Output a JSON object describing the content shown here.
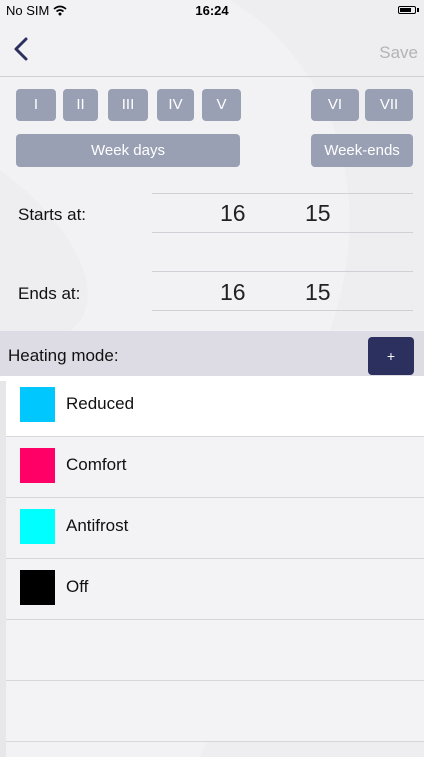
{
  "status_bar": {
    "carrier": "No SIM",
    "time": "16:24"
  },
  "nav": {
    "back_icon": "chevron-left-icon",
    "save_label": "Save",
    "back_color": "#2c305f",
    "save_color": "#b3b3b8"
  },
  "days": {
    "weekdays": [
      "I",
      "II",
      "III",
      "IV",
      "V"
    ],
    "weekend": [
      "VI",
      "VII"
    ],
    "week_days_label": "Week days",
    "week_ends_label": "Week-ends",
    "button_color": "#9aa0b4"
  },
  "schedule": {
    "starts_label": "Starts at:",
    "starts_hour": "16",
    "starts_minute": "15",
    "ends_label": "Ends at:",
    "ends_hour": "16",
    "ends_minute": "15"
  },
  "heating": {
    "header_label": "Heating mode:",
    "add_label": "+",
    "add_color": "#2c305f",
    "modes": [
      {
        "label": "Reduced",
        "color": "#00c8ff"
      },
      {
        "label": "Comfort",
        "color": "#ff0066"
      },
      {
        "label": "Antifrost",
        "color": "#00ffff"
      },
      {
        "label": "Off",
        "color": "#000000"
      }
    ]
  }
}
